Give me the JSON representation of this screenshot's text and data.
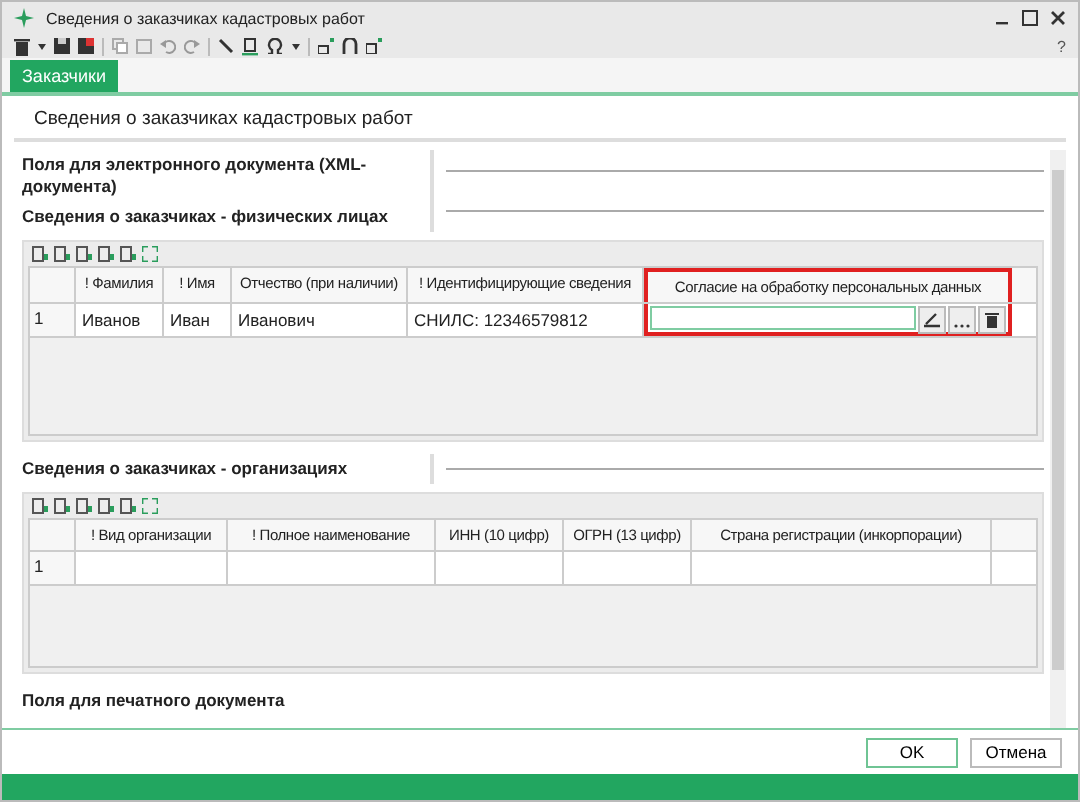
{
  "window": {
    "title": "Сведения о заказчиках кадастровых работ",
    "help": "?"
  },
  "tabs": [
    {
      "label": "Заказчики",
      "selected": true
    }
  ],
  "page_title": "Сведения о заказчиках кадастровых работ",
  "electronic_section": {
    "title": "Поля для электронного документа (XML-документа)"
  },
  "persons": {
    "title": "Сведения о заказчиках - физических лицах",
    "columns": [
      {
        "label": "! Фамилия",
        "highlighted": false
      },
      {
        "label": "! Имя",
        "highlighted": false
      },
      {
        "label": "Отчество (при наличии)",
        "highlighted": false
      },
      {
        "label": "! Идентифицирующие сведения",
        "highlighted": false
      },
      {
        "label": "Согласие на обработку персональных данных",
        "highlighted": true
      }
    ],
    "rows": [
      {
        "number": "1",
        "cells": [
          "Иванов",
          "Иван",
          "Иванович",
          "СНИЛС: 12346579812",
          ""
        ]
      }
    ]
  },
  "organizations": {
    "title": "Сведения о заказчиках - организациях",
    "columns": [
      {
        "label": "! Вид организации"
      },
      {
        "label": "! Полное наименование"
      },
      {
        "label": "ИНН (10 цифр)"
      },
      {
        "label": "ОГРН (13 цифр)"
      },
      {
        "label": "Страна регистрации (инкорпорации)"
      }
    ],
    "rows": [
      {
        "number": "1"
      }
    ]
  },
  "print_section": {
    "title": "Поля для печатного документа"
  },
  "buttons": [
    {
      "label": "OK",
      "default": true
    },
    {
      "label": "Отмена",
      "default": false
    }
  ]
}
